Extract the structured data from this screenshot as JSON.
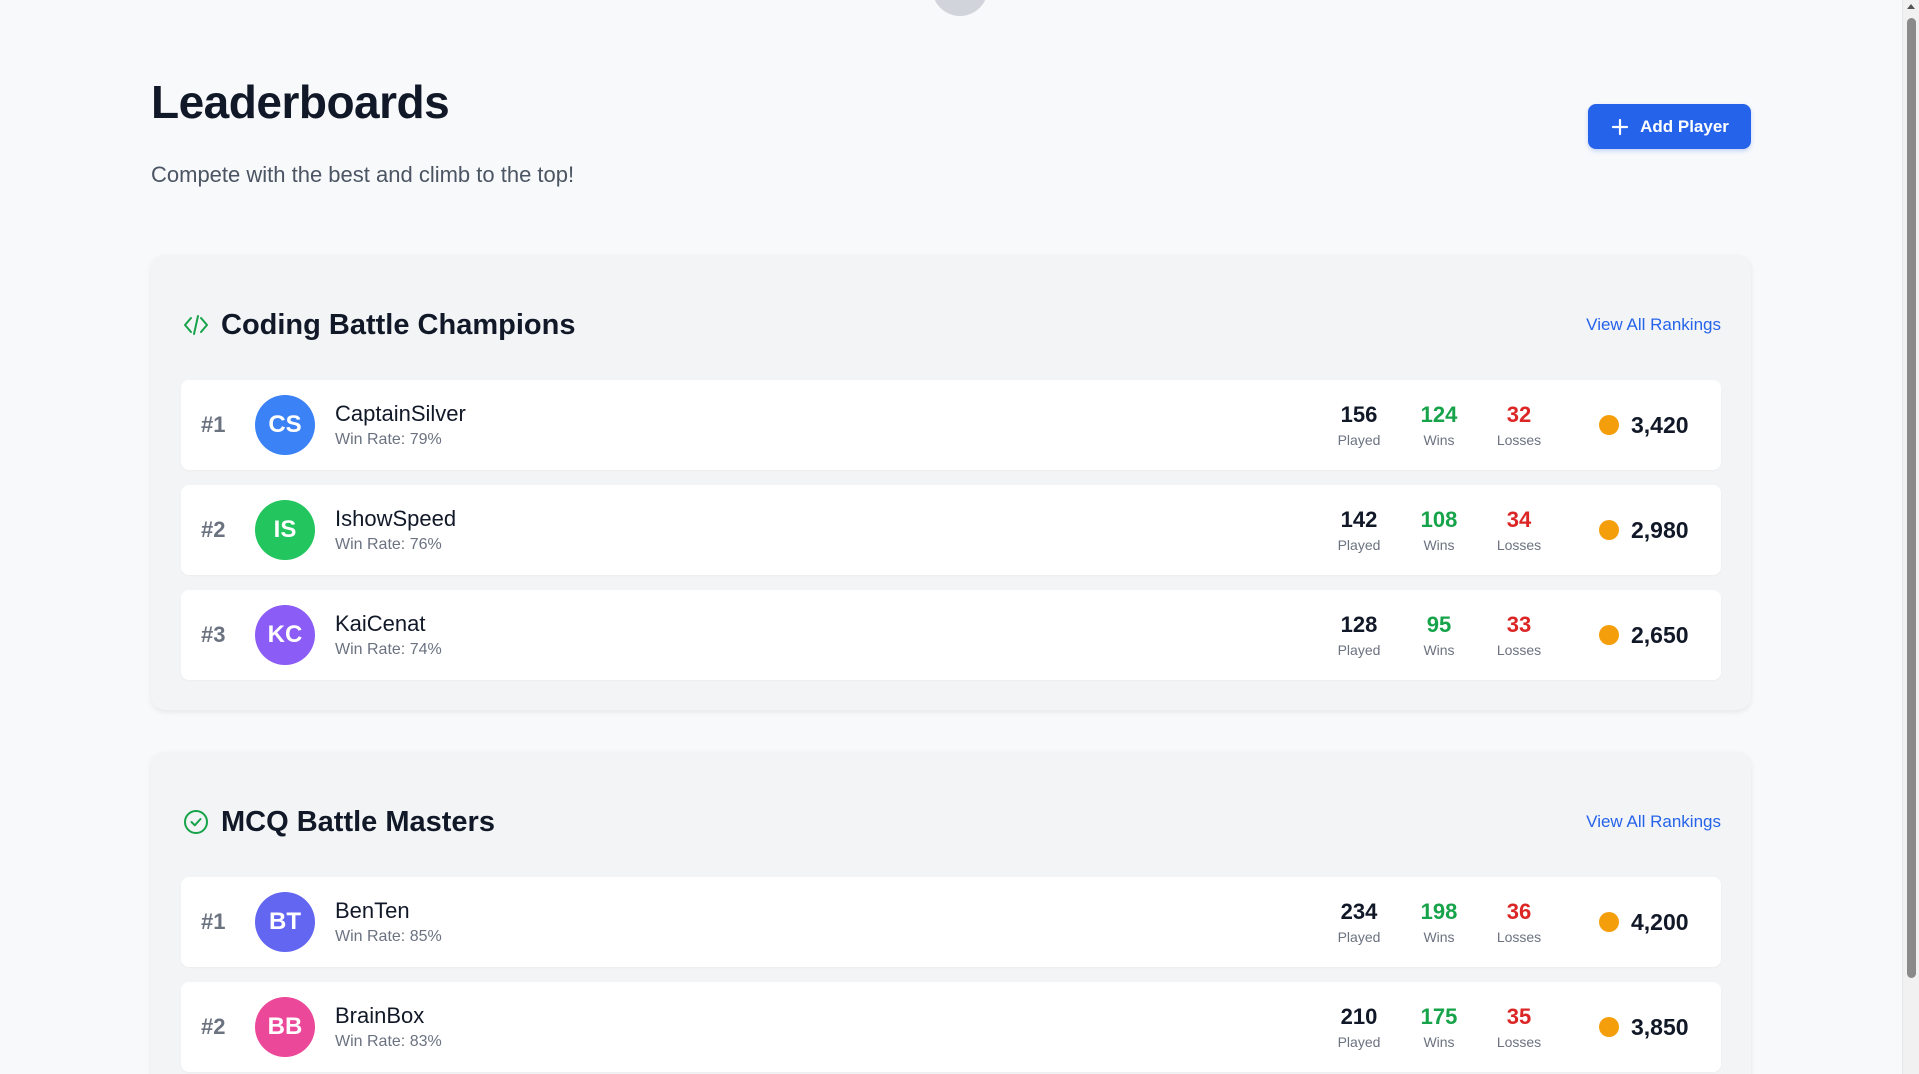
{
  "page": {
    "title": "Leaderboards",
    "subtitle": "Compete with the best and climb to the top!",
    "add_player_label": "Add Player"
  },
  "colors": {
    "accent": "#2563eb",
    "wins": "#16a34a",
    "losses": "#dc2626",
    "coin": "#f59e0b"
  },
  "boards": [
    {
      "title": "Coding Battle Champions",
      "icon": "code-icon",
      "view_all_label": "View All Rankings",
      "players": [
        {
          "rank": "#1",
          "initials": "CS",
          "avatar_color": "#3b82f6",
          "name": "CaptainSilver",
          "win_rate": "Win Rate: 79%",
          "played": "156",
          "wins": "124",
          "losses": "32",
          "score": "3,420"
        },
        {
          "rank": "#2",
          "initials": "IS",
          "avatar_color": "#22c55e",
          "name": "IshowSpeed",
          "win_rate": "Win Rate: 76%",
          "played": "142",
          "wins": "108",
          "losses": "34",
          "score": "2,980"
        },
        {
          "rank": "#3",
          "initials": "KC",
          "avatar_color": "#8b5cf6",
          "name": "KaiCenat",
          "win_rate": "Win Rate: 74%",
          "played": "128",
          "wins": "95",
          "losses": "33",
          "score": "2,650"
        }
      ]
    },
    {
      "title": "MCQ Battle Masters",
      "icon": "check-circle-icon",
      "view_all_label": "View All Rankings",
      "players": [
        {
          "rank": "#1",
          "initials": "BT",
          "avatar_color": "#6366f1",
          "name": "BenTen",
          "win_rate": "Win Rate: 85%",
          "played": "234",
          "wins": "198",
          "losses": "36",
          "score": "4,200"
        },
        {
          "rank": "#2",
          "initials": "BB",
          "avatar_color": "#ec4899",
          "name": "BrainBox",
          "win_rate": "Win Rate: 83%",
          "played": "210",
          "wins": "175",
          "losses": "35",
          "score": "3,850"
        }
      ]
    }
  ],
  "labels": {
    "played": "Played",
    "wins": "Wins",
    "losses": "Losses"
  }
}
